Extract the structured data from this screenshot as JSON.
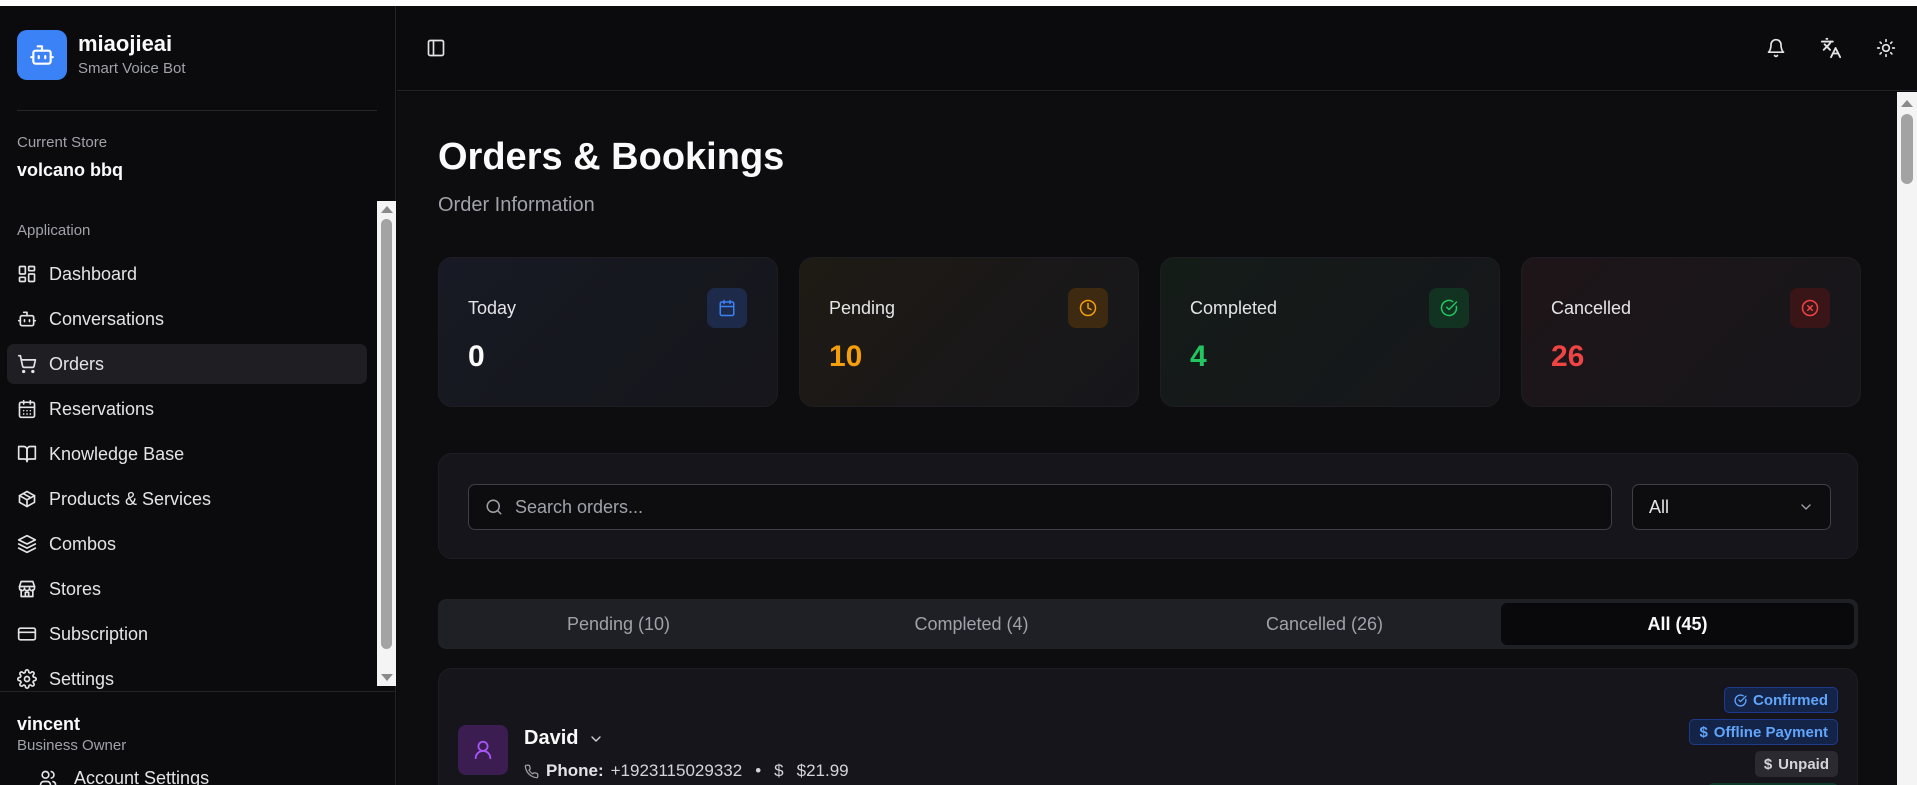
{
  "brand": {
    "name": "miaojieai",
    "subtitle": "Smart Voice Bot",
    "logo_icon": "bot-icon",
    "color": "#3b82f6"
  },
  "store": {
    "label": "Current Store",
    "name": "volcano bbq"
  },
  "nav": {
    "section_label": "Application",
    "items": [
      {
        "label": "Dashboard",
        "icon": "dashboard-icon"
      },
      {
        "label": "Conversations",
        "icon": "bot-icon"
      },
      {
        "label": "Orders",
        "icon": "cart-icon",
        "active": true
      },
      {
        "label": "Reservations",
        "icon": "calendar-icon"
      },
      {
        "label": "Knowledge Base",
        "icon": "book-icon"
      },
      {
        "label": "Products & Services",
        "icon": "package-icon"
      },
      {
        "label": "Combos",
        "icon": "layers-icon"
      },
      {
        "label": "Stores",
        "icon": "store-icon"
      },
      {
        "label": "Subscription",
        "icon": "credit-card-icon"
      },
      {
        "label": "Settings",
        "icon": "gear-icon"
      }
    ]
  },
  "user": {
    "name": "vincent",
    "role": "Business Owner",
    "account_link": "Account Settings"
  },
  "topbar": {
    "icons": [
      "sidebar-toggle-icon",
      "bell-icon",
      "translate-icon",
      "sun-icon"
    ]
  },
  "page": {
    "title": "Orders & Bookings",
    "subtitle": "Order Information"
  },
  "stats": [
    {
      "label": "Today",
      "value": "0",
      "color": "#fafafa",
      "icon": "calendar-icon",
      "accent": "#3b82f6"
    },
    {
      "label": "Pending",
      "value": "10",
      "color": "#f59e0b",
      "icon": "clock-icon",
      "accent": "#f59e0b"
    },
    {
      "label": "Completed",
      "value": "4",
      "color": "#22c55e",
      "icon": "check-circle-icon",
      "accent": "#22c55e"
    },
    {
      "label": "Cancelled",
      "value": "26",
      "color": "#ef4444",
      "icon": "x-circle-icon",
      "accent": "#ef4444"
    }
  ],
  "filters": {
    "search_placeholder": "Search orders...",
    "status_value": "All"
  },
  "tabs": [
    {
      "label": "Pending (10)"
    },
    {
      "label": "Completed (4)"
    },
    {
      "label": "Cancelled (26)"
    },
    {
      "label": "All (45)",
      "active": true
    }
  ],
  "orders": [
    {
      "customer": "David",
      "phone_label": "Phone:",
      "phone": "+1923115029332",
      "separator": "•",
      "currency": "$",
      "amount": "$21.99",
      "badges": {
        "status": "Confirmed",
        "payment_method": "Offline Payment",
        "payment_status": "Unpaid"
      }
    }
  ]
}
